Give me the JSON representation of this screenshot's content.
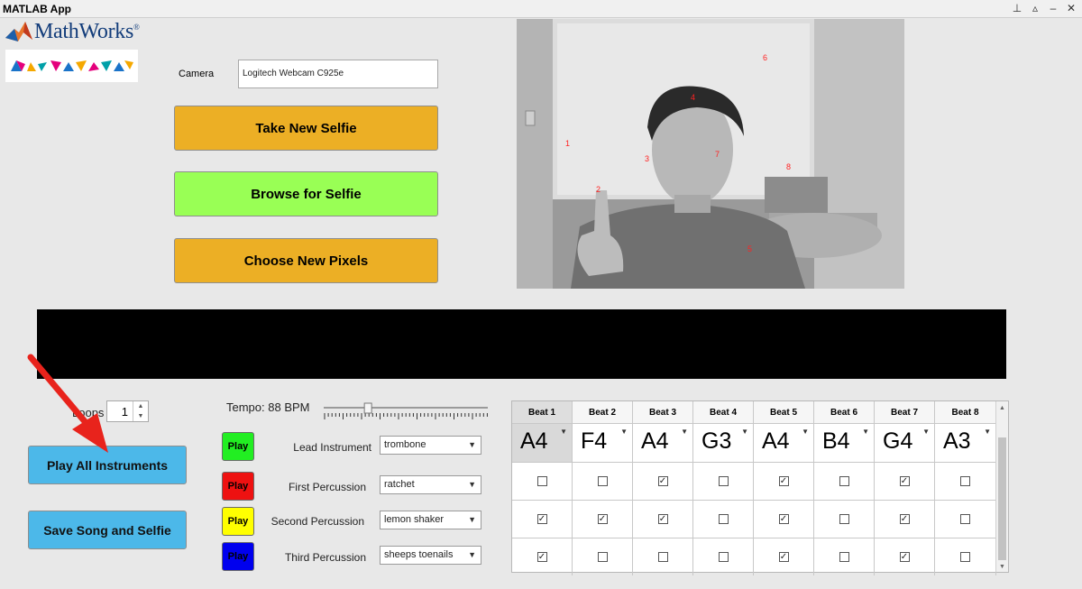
{
  "window": {
    "title": "MATLAB App",
    "controls": [
      "pin-icon",
      "restore-icon",
      "minimize-icon",
      "close-icon"
    ]
  },
  "logo": {
    "text": "MathWorks",
    "mark": "®"
  },
  "camera": {
    "label": "Camera",
    "value": "Logitech Webcam C925e"
  },
  "buttons": {
    "take_selfie": "Take New Selfie",
    "browse_selfie": "Browse for Selfie",
    "choose_pixels": "Choose New Pixels",
    "play_all": "Play All Instruments",
    "save": "Save Song and Selfie"
  },
  "photo": {
    "pixel_labels": [
      "1",
      "2",
      "3",
      "4",
      "5",
      "6",
      "7",
      "8"
    ]
  },
  "loops": {
    "label": "Loops",
    "value": "1"
  },
  "tempo": {
    "label": "Tempo: 88 BPM",
    "bpm": 88,
    "level": 0.27
  },
  "instruments": [
    {
      "play": "Play",
      "label": "Lead Instrument",
      "value": "trombone",
      "color": "#22ee22"
    },
    {
      "play": "Play",
      "label": "First Percussion",
      "value": "ratchet",
      "color": "#ee1111"
    },
    {
      "play": "Play",
      "label": "Second Percussion",
      "value": "lemon shaker",
      "color": "#ffff00"
    },
    {
      "play": "Play",
      "label": "Third Percussion",
      "value": "sheeps toenails",
      "color": "#0000ee"
    }
  ],
  "beats": {
    "headers": [
      "Beat 1",
      "Beat 2",
      "Beat 3",
      "Beat 4",
      "Beat 5",
      "Beat 6",
      "Beat 7",
      "Beat 8"
    ],
    "notes": [
      "A4",
      "F4",
      "A4",
      "G3",
      "A4",
      "B4",
      "G4",
      "A3"
    ],
    "checks": [
      [
        false,
        false,
        true,
        false,
        true,
        false,
        true,
        false
      ],
      [
        true,
        true,
        true,
        false,
        true,
        false,
        true,
        false
      ],
      [
        true,
        false,
        false,
        false,
        true,
        false,
        true,
        false
      ]
    ]
  },
  "colors": {
    "orange": "#ecaf25",
    "green": "#99ff55",
    "blue": "#4cb8e9",
    "arrow": "#e8231c"
  }
}
